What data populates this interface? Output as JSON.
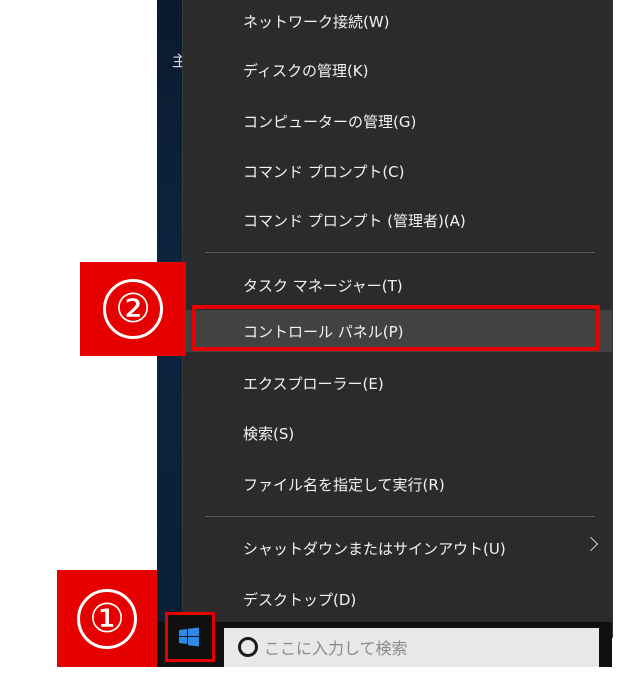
{
  "menu": {
    "items": [
      {
        "label": "ネットワーク接続(W)"
      },
      {
        "label": "ディスクの管理(K)"
      },
      {
        "label": "コンピューターの管理(G)"
      },
      {
        "label": "コマンド プロンプト(C)"
      },
      {
        "label": "コマンド プロンプト (管理者)(A)"
      },
      {
        "label": "タスク マネージャー(T)"
      },
      {
        "label": "コントロール パネル(P)"
      },
      {
        "label": "エクスプローラー(E)"
      },
      {
        "label": "検索(S)"
      },
      {
        "label": "ファイル名を指定して実行(R)"
      },
      {
        "label": "シャットダウンまたはサインアウト(U)"
      },
      {
        "label": "デスクトップ(D)"
      }
    ],
    "highlighted_item": "コントロール パネル(P)"
  },
  "desktop": {
    "partial_text": "主"
  },
  "taskbar": {
    "search_placeholder": "ここに入力して検索",
    "start_icon": "windows-logo-icon"
  },
  "annotations": {
    "step1": "①",
    "step2": "②",
    "color": "#e60000"
  },
  "colors": {
    "menu_bg": "#2b2b2b",
    "menu_highlight": "#424242",
    "accent_blue": "#2d8ae6"
  }
}
